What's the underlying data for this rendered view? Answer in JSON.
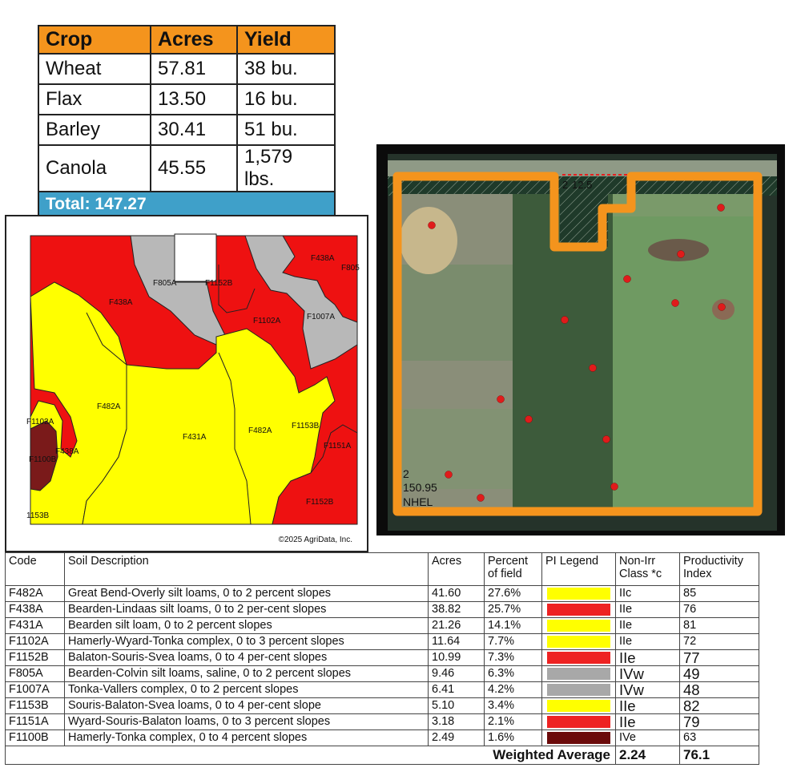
{
  "crop_table": {
    "headers": [
      "Crop",
      "Acres",
      "Yield"
    ],
    "rows": [
      {
        "crop": "Wheat",
        "acres": "57.81",
        "yield": "38 bu."
      },
      {
        "crop": "Flax",
        "acres": "13.50",
        "yield": "16 bu."
      },
      {
        "crop": "Barley",
        "acres": "30.41",
        "yield": "51 bu."
      },
      {
        "crop": "Canola",
        "acres": "45.55",
        "yield": "1,579 lbs."
      }
    ],
    "total": "Total:  147.27"
  },
  "soil_map": {
    "labels": {
      "F805A_top": "F805A",
      "F1152B_top": "F1152B",
      "F438A_top": "F438A",
      "F805_edge": "F805",
      "F438A_left": "F438A",
      "F1102A": "F1102A",
      "F1007A": "F1007A",
      "F482A_left": "F482A",
      "F431A": "F431A",
      "F482A_mid": "F482A",
      "F1153B": "F1153B",
      "F1151A": "F1151A",
      "F1102A_left": "F1102A",
      "F438A_left2": "F438A",
      "F1100B": "F1100B",
      "F1152B_bottom": "F1152B",
      "1153B_bottom": "1153B"
    },
    "copyright": "©2025 AgriData, Inc.",
    "colors": {
      "red": "#ee1111",
      "yellow": "#ffff00",
      "gray": "#b8b8b8",
      "dark": "#7a1a1a"
    }
  },
  "aerial": {
    "field_number": "2",
    "field_acres": "150.95",
    "field_code": "NHEL",
    "strip_label": "2",
    "strip_acres": "12.5",
    "boundary_color": "#f4941d",
    "marker_color": "#e01b1b"
  },
  "soil_table": {
    "headers": {
      "code": "Code",
      "description": "Soil Description",
      "acres": "Acres",
      "percent": "Percent of field",
      "legend": "PI Legend",
      "class": "Non-Irr Class *c",
      "index": "Productivity Index"
    },
    "rows": [
      {
        "code": "F482A",
        "description": "Great Bend-Overly silt loams, 0 to 2 percent slopes",
        "acres": "41.60",
        "percent": "27.6%",
        "color": "#ffff00",
        "class": "IIc",
        "index": "85"
      },
      {
        "code": "F438A",
        "description": "Bearden-Lindaas silt loams, 0 to 2 per-cent slopes",
        "acres": "38.82",
        "percent": "25.7%",
        "color": "#ee2222",
        "class": "IIe",
        "index": "76"
      },
      {
        "code": "F431A",
        "description": "Bearden silt loam, 0 to 2 percent slopes",
        "acres": "21.26",
        "percent": "14.1%",
        "color": "#ffff00",
        "class": "IIe",
        "index": "81"
      },
      {
        "code": "F1102A",
        "description": "Hamerly-Wyard-Tonka complex, 0 to 3 percent slopes",
        "acres": "11.64",
        "percent": "7.7%",
        "color": "#ffff00",
        "class": "IIe",
        "index": "72"
      },
      {
        "code": "F1152B",
        "description": "Balaton-Souris-Svea loams, 0 to 4 per-cent slopes",
        "acres": "10.99",
        "percent": "7.3%",
        "color": "#ee2222",
        "class": "IIe",
        "index": "77"
      },
      {
        "code": "F805A",
        "description": "Bearden-Colvin silt loams, saline, 0 to 2 percent slopes",
        "acres": "9.46",
        "percent": "6.3%",
        "color": "#a8a8a8",
        "class": "IVw",
        "index": "49"
      },
      {
        "code": "F1007A",
        "description": "Tonka-Vallers complex, 0 to 2 percent slopes",
        "acres": "6.41",
        "percent": "4.2%",
        "color": "#a8a8a8",
        "class": "IVw",
        "index": "48"
      },
      {
        "code": "F1153B",
        "description": "Souris-Balaton-Svea loams, 0 to 4 per-cent slope",
        "acres": "5.10",
        "percent": "3.4%",
        "color": "#ffff00",
        "class": "IIe",
        "index": "82"
      },
      {
        "code": "F1151A",
        "description": "Wyard-Souris-Balaton loams, 0 to 3 percent slopes",
        "acres": "3.18",
        "percent": "2.1%",
        "color": "#ee2222",
        "class": "IIe",
        "index": "79"
      },
      {
        "code": "F1100B",
        "description": "Hamerly-Tonka complex, 0 to 4 percent slopes",
        "acres": "2.49",
        "percent": "1.6%",
        "color": "#6b0a0a",
        "class": "IVe",
        "index": "63"
      }
    ],
    "weighted_label": "Weighted Average",
    "weighted_class": "2.24",
    "weighted_index": "76.1"
  }
}
